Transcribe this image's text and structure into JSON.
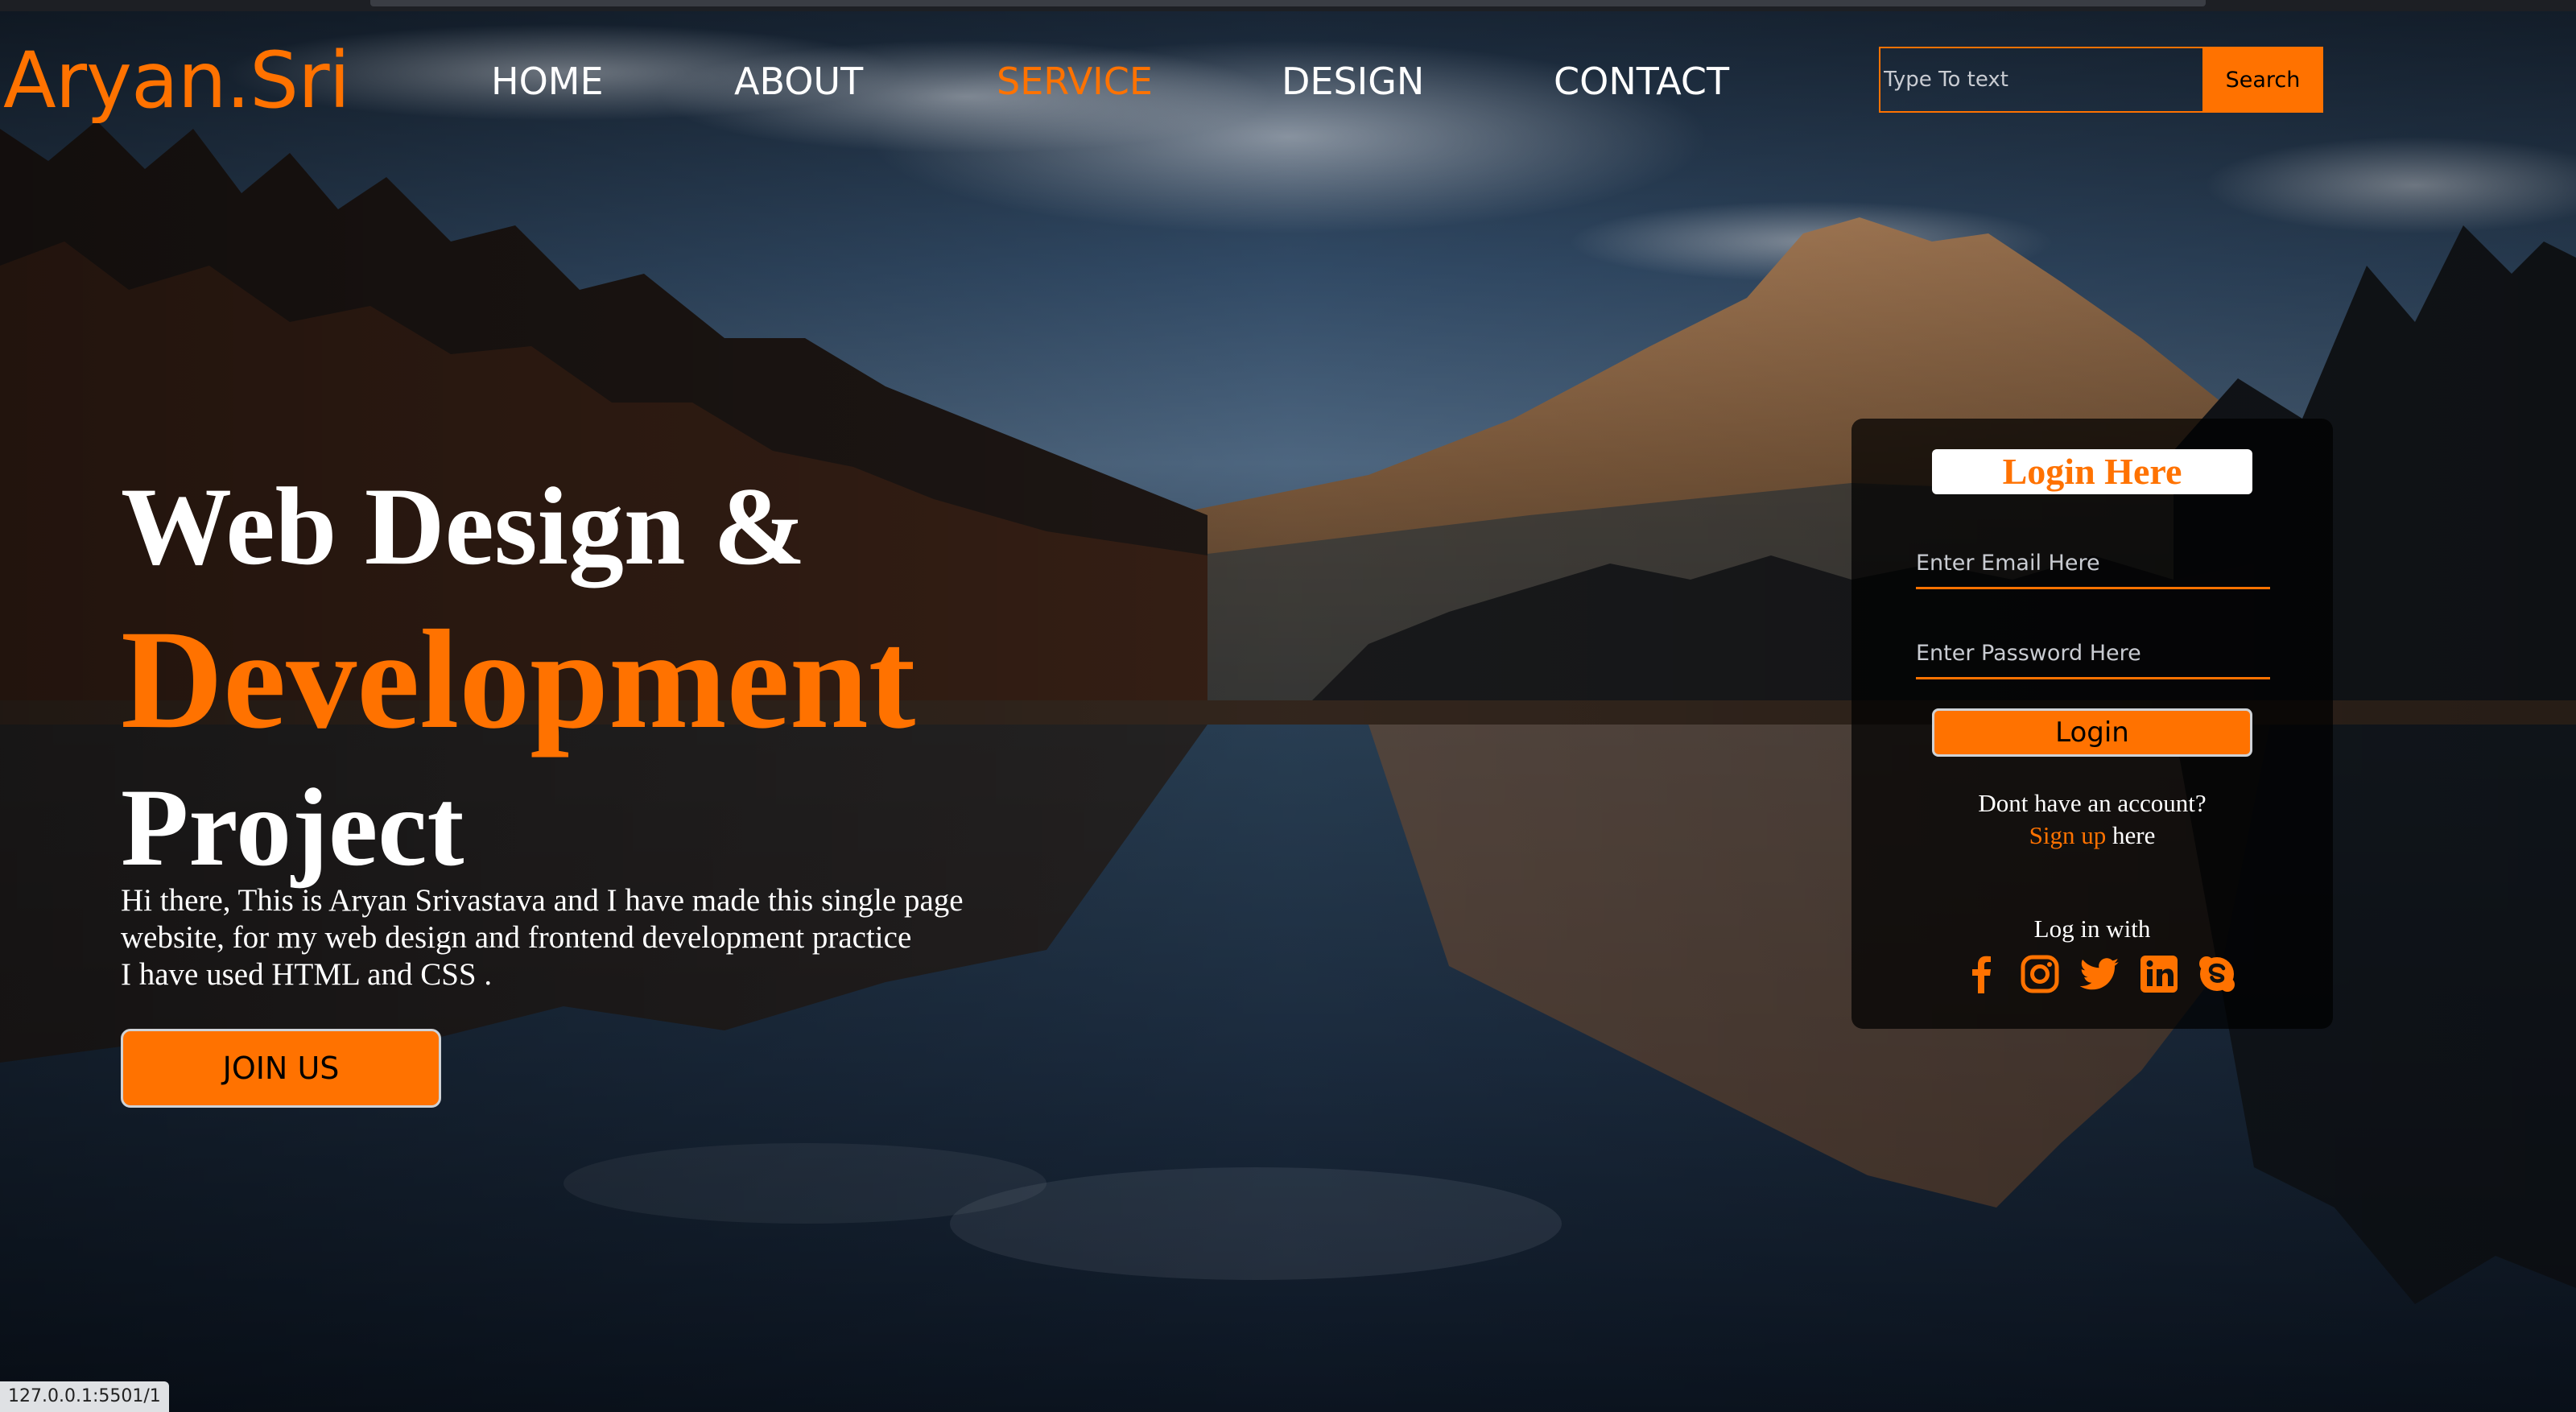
{
  "logo": "Aryan.Sri",
  "nav": {
    "items": [
      {
        "label": "HOME",
        "active": false
      },
      {
        "label": "ABOUT",
        "active": false
      },
      {
        "label": "SERVICE",
        "active": true
      },
      {
        "label": "DESIGN",
        "active": false
      },
      {
        "label": "CONTACT",
        "active": false
      }
    ]
  },
  "search": {
    "placeholder": "Type To text",
    "button": "Search"
  },
  "hero": {
    "line1": "Web Design &",
    "line2": "Development",
    "line3": "Project",
    "text_lines": [
      "Hi there, This is Aryan Srivastava and I have made this single page",
      "website, for my web design and frontend development practice",
      "I have used HTML and CSS ."
    ],
    "cta": "JOIN US"
  },
  "login": {
    "title": "Login Here",
    "email_placeholder": "Enter Email Here",
    "password_placeholder": "Enter Password Here",
    "button": "Login",
    "no_account": "Dont have an account?",
    "signup_link": "Sign up",
    "signup_suffix": " here",
    "login_with": "Log in with",
    "socials": [
      "facebook-icon",
      "instagram-icon",
      "twitter-icon",
      "linkedin-icon",
      "skype-icon"
    ]
  },
  "status_url": "127.0.0.1:5501/1",
  "colors": {
    "accent": "#ff7200",
    "text": "#ffffff",
    "card_bg": "rgba(0,0,0,0.72)"
  }
}
